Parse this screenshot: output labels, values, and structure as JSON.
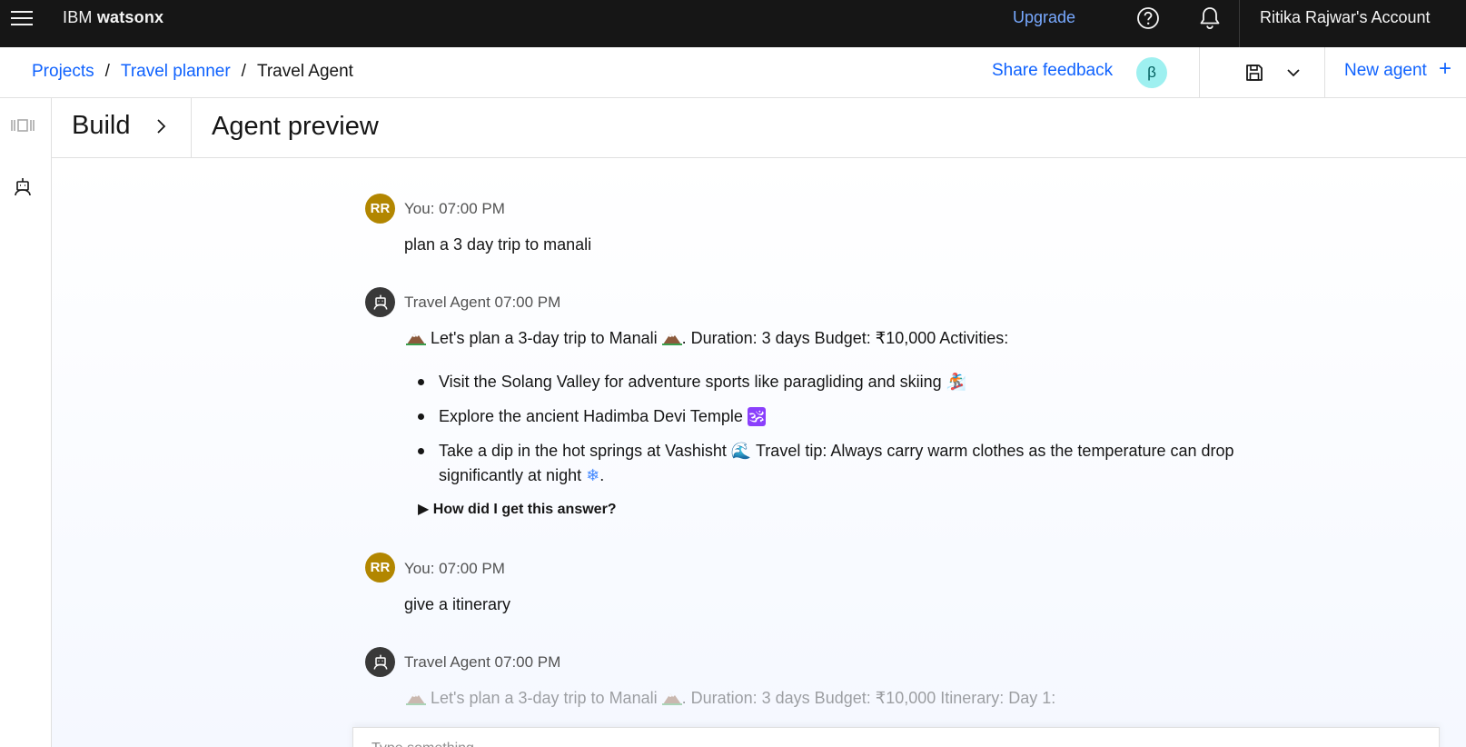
{
  "header": {
    "brand_prefix": "IBM",
    "brand_name": "watsonx",
    "upgrade_label": "Upgrade",
    "account_label": "Ritika Rajwar's Account"
  },
  "breadcrumb": {
    "items": [
      "Projects",
      "Travel planner"
    ],
    "separator": "/",
    "current": "Travel Agent"
  },
  "toolbar": {
    "share_feedback": "Share feedback",
    "beta_badge": "β",
    "new_agent": "New agent",
    "new_agent_icon": "+"
  },
  "panel": {
    "build_label": "Build",
    "preview_title": "Agent preview"
  },
  "chat": {
    "messages": [
      {
        "author": "You:",
        "time": "07:00 PM",
        "avatar": "RR",
        "text": "plan a 3 day trip to manali"
      },
      {
        "author": "Travel Agent",
        "time": "07:00 PM",
        "intro_a": "Let's plan a 3-day trip to Manali",
        "intro_b": ". Duration: 3 days Budget: ₹10,000 Activities:",
        "bullets": [
          {
            "text": "Visit the Solang Valley for adventure sports like paragliding and skiing",
            "emoji": "🏂"
          },
          {
            "text": "Explore the ancient Hadimba Devi Temple",
            "emoji": "🕉"
          },
          {
            "text": "Take a dip in the hot springs at Vashisht",
            "emoji": "🌊",
            "text2": "Travel tip: Always carry warm clothes as the temperature can drop",
            "text3": "significantly at night",
            "emoji2": "❄",
            "end": "."
          }
        ],
        "how_label": "How did I get this answer?"
      },
      {
        "author": "You:",
        "time": "07:00 PM",
        "avatar": "RR",
        "text": "give a itinerary"
      },
      {
        "author": "Travel Agent",
        "time": "07:00 PM",
        "intro_a": "Let's plan a 3-day trip to Manali",
        "intro_b": ". Duration: 3 days Budget: ₹10,000 Itinerary: Day 1:"
      }
    ],
    "input_placeholder": "Type something..."
  },
  "colors": {
    "header_bg": "#161616",
    "link_blue": "#0f62fe",
    "upgrade_blue": "#78a9ff",
    "user_avatar": "#b28600",
    "bot_avatar": "#393939",
    "beta_bg": "#9ef0f0"
  },
  "icons": {
    "menu": "hamburger-menu-icon",
    "help": "help-circle-icon",
    "notifications": "bell-icon",
    "save": "save-icon",
    "dropdown": "chevron-down-icon",
    "rail_1": "flow-icon",
    "rail_2": "robot-icon",
    "build_expand": "chevron-right-icon"
  }
}
